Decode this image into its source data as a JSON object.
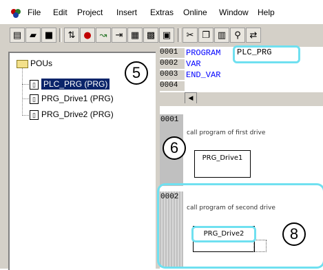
{
  "menu": [
    "File",
    "Edit",
    "Project",
    "Insert",
    "Extras",
    "Online",
    "Window",
    "Help"
  ],
  "toolbar_icons": [
    "new-icon",
    "open-icon",
    "save-icon",
    "build-icon",
    "stop-icon",
    "run-icon",
    "step-icon",
    "login-icon",
    "logout-icon",
    "download-icon",
    "cut-icon",
    "copy-icon",
    "paste-icon",
    "find-icon",
    "replace-icon"
  ],
  "tree": {
    "root": "POUs",
    "items": [
      "PLC_PRG (PRG)",
      "PRG_Drive1 (PRG)",
      "PRG_Drive2 (PRG)"
    ],
    "selected": 0
  },
  "declaration": {
    "lines": [
      {
        "num": "0001",
        "text": "PROGRAM",
        "name": "PLC_PRG"
      },
      {
        "num": "0002",
        "text": "VAR"
      },
      {
        "num": "0003",
        "text": "END_VAR"
      },
      {
        "num": "0004",
        "text": ""
      }
    ]
  },
  "networks": [
    {
      "num": "0001",
      "comment": "call program of first drive",
      "block": "PRG_Drive1"
    },
    {
      "num": "0002",
      "comment": "call program of second drive",
      "block": "PRG_Drive2"
    }
  ],
  "callouts": [
    "5",
    "6",
    "8"
  ],
  "accent": "#6fe0f0"
}
